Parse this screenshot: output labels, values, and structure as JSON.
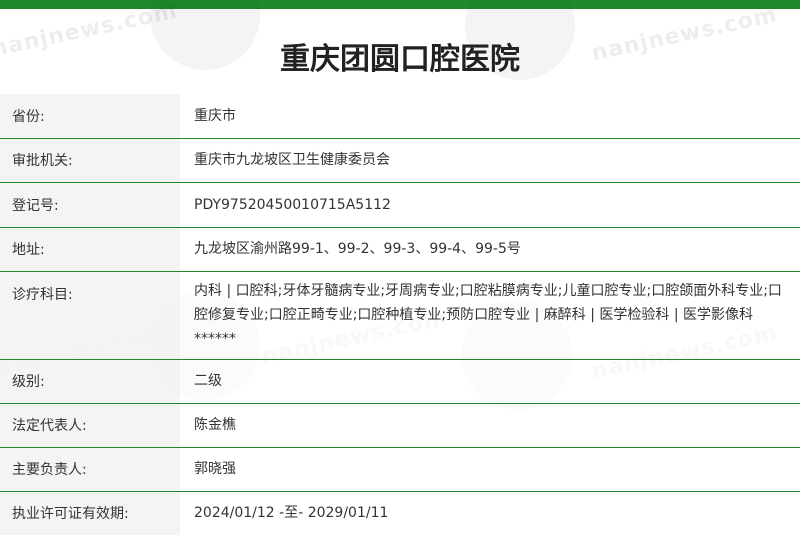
{
  "watermark": "nanjnews.com",
  "page": {
    "title": "重庆团圆口腔医院"
  },
  "rows": [
    {
      "label": "省份:",
      "value": "重庆市"
    },
    {
      "label": "审批机关:",
      "value": "重庆市九龙坡区卫生健康委员会"
    },
    {
      "label": "登记号:",
      "value": "PDY97520450010715A5112"
    },
    {
      "label": "地址:",
      "value": "九龙坡区渝州路99-1、99-2、99-3、99-4、99-5号"
    },
    {
      "label": "诊疗科目:",
      "value": "内科 | 口腔科;牙体牙髓病专业;牙周病专业;口腔粘膜病专业;儿童口腔专业;口腔颌面外科专业;口腔修复专业;口腔正畸专业;口腔种植专业;预防口腔专业 | 麻醉科 | 医学检验科 | 医学影像科******"
    },
    {
      "label": "级别:",
      "value": "二级"
    },
    {
      "label": "法定代表人:",
      "value": "陈金樵"
    },
    {
      "label": "主要负责人:",
      "value": "郭晓强"
    },
    {
      "label": "执业许可证有效期:",
      "value": "2024/01/12 -至- 2029/01/11"
    }
  ]
}
